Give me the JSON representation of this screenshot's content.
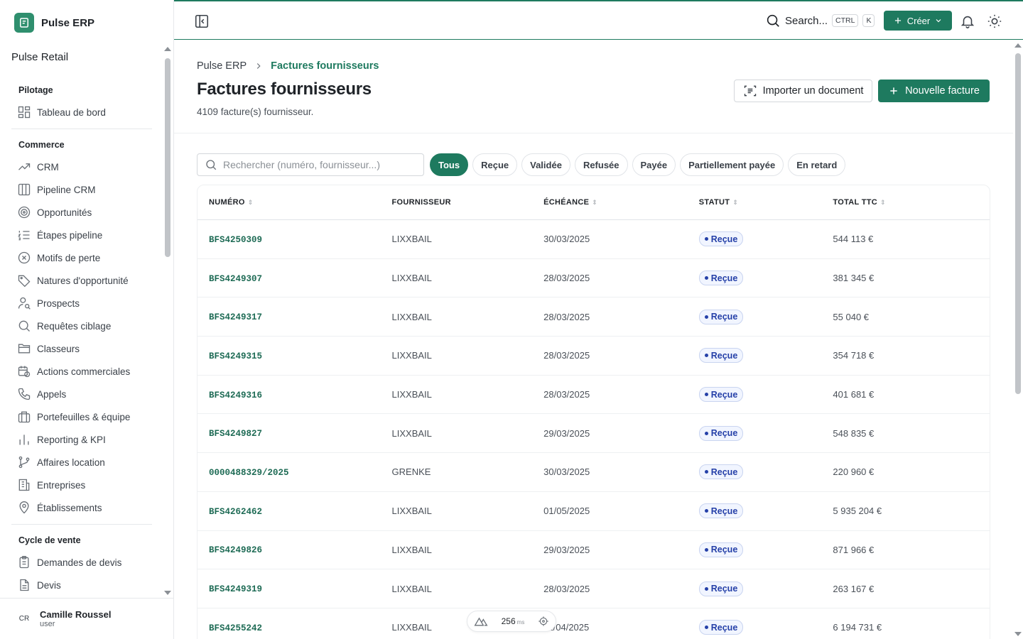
{
  "app": {
    "name": "Pulse ERP",
    "org": "Pulse Retail"
  },
  "user": {
    "initials": "CR",
    "name": "Camille Roussel",
    "role": "user"
  },
  "topbar": {
    "search_label": "Search...",
    "kbd_ctrl": "CTRL",
    "kbd_k": "K",
    "create_label": "Créer"
  },
  "sidebar": {
    "sections": [
      {
        "title": "Pilotage",
        "items": [
          {
            "label": "Tableau de bord",
            "icon": "dashboard-icon"
          }
        ]
      },
      {
        "title": "Commerce",
        "items": [
          {
            "label": "CRM",
            "icon": "trend-icon"
          },
          {
            "label": "Pipeline CRM",
            "icon": "kanban-icon"
          },
          {
            "label": "Opportunités",
            "icon": "target-icon"
          },
          {
            "label": "Étapes pipeline",
            "icon": "list-ordered-icon"
          },
          {
            "label": "Motifs de perte",
            "icon": "x-circle-icon"
          },
          {
            "label": "Natures d'opportunité",
            "icon": "tag-icon"
          },
          {
            "label": "Prospects",
            "icon": "user-search-icon"
          },
          {
            "label": "Requêtes ciblage",
            "icon": "search-icon"
          },
          {
            "label": "Classeurs",
            "icon": "folder-open-icon"
          },
          {
            "label": "Actions commerciales",
            "icon": "calendar-clock-icon"
          },
          {
            "label": "Appels",
            "icon": "phone-icon"
          },
          {
            "label": "Portefeuilles & équipe",
            "icon": "briefcase-icon"
          },
          {
            "label": "Reporting & KPI",
            "icon": "bar-chart-icon"
          },
          {
            "label": "Affaires location",
            "icon": "git-branch-icon"
          },
          {
            "label": "Entreprises",
            "icon": "building-icon"
          },
          {
            "label": "Établissements",
            "icon": "map-pin-icon"
          }
        ]
      },
      {
        "title": "Cycle de vente",
        "items": [
          {
            "label": "Demandes de devis",
            "icon": "clipboard-list-icon"
          },
          {
            "label": "Devis",
            "icon": "file-text-icon"
          }
        ]
      }
    ]
  },
  "page": {
    "breadcrumb_root": "Pulse ERP",
    "breadcrumb_current": "Factures fournisseurs",
    "title": "Factures fournisseurs",
    "subtitle": "4109 facture(s) fournisseur.",
    "import_label": "Importer un document",
    "new_label": "Nouvelle facture",
    "search_placeholder": "Rechercher (numéro, fournisseur...)",
    "filters": [
      "Tous",
      "Reçue",
      "Validée",
      "Refusée",
      "Payée",
      "Partiellement payée",
      "En retard"
    ],
    "active_filter": "Tous"
  },
  "table": {
    "columns": [
      "NUMÉRO",
      "FOURNISSEUR",
      "ÉCHÉANCE",
      "STATUT",
      "TOTAL TTC"
    ],
    "rows": [
      {
        "numero": "BFS4250309",
        "fournisseur": "LIXXBAIL",
        "echeance": "30/03/2025",
        "statut": "Reçue",
        "total": "544 113 €"
      },
      {
        "numero": "BFS4249307",
        "fournisseur": "LIXXBAIL",
        "echeance": "28/03/2025",
        "statut": "Reçue",
        "total": "381 345 €"
      },
      {
        "numero": "BFS4249317",
        "fournisseur": "LIXXBAIL",
        "echeance": "28/03/2025",
        "statut": "Reçue",
        "total": "55 040 €"
      },
      {
        "numero": "BFS4249315",
        "fournisseur": "LIXXBAIL",
        "echeance": "28/03/2025",
        "statut": "Reçue",
        "total": "354 718 €"
      },
      {
        "numero": "BFS4249316",
        "fournisseur": "LIXXBAIL",
        "echeance": "28/03/2025",
        "statut": "Reçue",
        "total": "401 681 €"
      },
      {
        "numero": "BFS4249827",
        "fournisseur": "LIXXBAIL",
        "echeance": "29/03/2025",
        "statut": "Reçue",
        "total": "548 835 €"
      },
      {
        "numero": "0000488329/2025",
        "fournisseur": "GRENKE",
        "echeance": "30/03/2025",
        "statut": "Reçue",
        "total": "220 960 €"
      },
      {
        "numero": "BFS4262462",
        "fournisseur": "LIXXBAIL",
        "echeance": "01/05/2025",
        "statut": "Reçue",
        "total": "5 935 204 €"
      },
      {
        "numero": "BFS4249826",
        "fournisseur": "LIXXBAIL",
        "echeance": "29/03/2025",
        "statut": "Reçue",
        "total": "871 966 €"
      },
      {
        "numero": "BFS4249319",
        "fournisseur": "LIXXBAIL",
        "echeance": "28/03/2025",
        "statut": "Reçue",
        "total": "263 167 €"
      },
      {
        "numero": "BFS4255242",
        "fournisseur": "LIXXBAIL",
        "echeance": "11/04/2025",
        "statut": "Reçue",
        "total": "6 194 731 €"
      }
    ]
  },
  "devbar": {
    "value": "256",
    "unit": "ms"
  },
  "colors": {
    "accent": "#1e7a5f",
    "badge_text": "#2540a8",
    "badge_bg": "#f1f5ff"
  }
}
